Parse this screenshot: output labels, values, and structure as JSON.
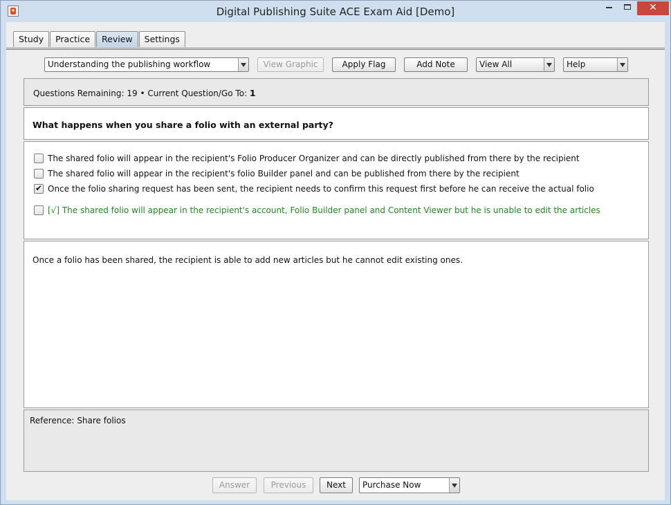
{
  "window": {
    "title": "Digital Publishing Suite ACE Exam Aid [Demo]",
    "close_glyph": "✕"
  },
  "tabs": [
    {
      "label": "Study"
    },
    {
      "label": "Practice"
    },
    {
      "label": "Review"
    },
    {
      "label": "Settings"
    }
  ],
  "active_tab": "Review",
  "toolbar": {
    "topic_selected": "Understanding the publishing workflow",
    "view_graphic": "View Graphic",
    "apply_flag": "Apply Flag",
    "add_note": "Add Note",
    "view_selected": "View All",
    "help_selected": "Help"
  },
  "status": {
    "questions_remaining_label": "Questions Remaining:",
    "questions_remaining_value": "19",
    "separator": "•",
    "current_question_label": "Current Question/Go To:",
    "current_question_value": "1"
  },
  "question": {
    "text": "What happens when you share a folio with an external party?"
  },
  "answers": [
    {
      "text": "The shared folio will appear in the recipient's Folio Producer Organizer and can be directly published from there by the recipient",
      "checked": false,
      "correct": false
    },
    {
      "text": "The shared folio will appear in the recipient's folio Builder panel and can be published from there by the recipient",
      "checked": false,
      "correct": false
    },
    {
      "text": "Once the folio sharing request has been sent, the recipient needs to confirm this request first before he can receive the actual folio",
      "checked": true,
      "correct": false
    },
    {
      "text": "[√] The shared folio will appear in the recipient's account, Folio Builder panel and Content Viewer but he is unable to edit the articles",
      "checked": false,
      "correct": true
    }
  ],
  "explanation": {
    "text": "Once a folio has been shared, the recipient is able to add new articles but he cannot edit existing ones."
  },
  "reference": {
    "label": "Reference:",
    "value": "Share folios"
  },
  "bottom": {
    "answer": "Answer",
    "previous": "Previous",
    "next": "Next",
    "purchase_selected": "Purchase Now"
  },
  "colors": {
    "correct_answer": "#1f8a1f",
    "close_button": "#c9463d",
    "window_frame": "#cfdff0"
  }
}
